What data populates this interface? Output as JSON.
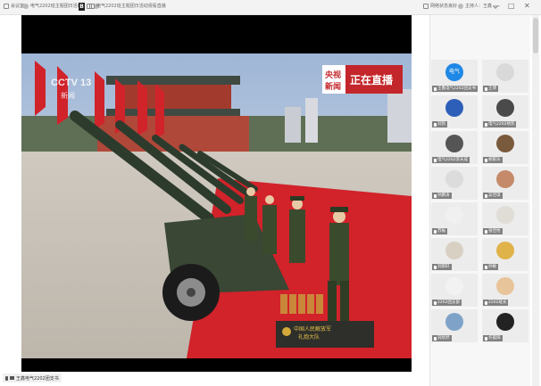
{
  "topbar": {
    "tab1": "会议室",
    "tab2": "电气2202班主题团日活动",
    "tab3": "电气2202班主题团日活动观看直播",
    "right1": "网络状态良好",
    "right2": "主持人：王鑫"
  },
  "window_controls": {
    "min": "—",
    "max": "□",
    "close": "✕"
  },
  "video": {
    "network_logo_line1": "CCTV 13",
    "network_logo_line2": "新闻",
    "live_bug_line1": "央视",
    "live_bug_line2": "新闻",
    "live_bug_label": "正在直播",
    "banner_line1": "中国人民解放军",
    "banner_line2": "礼炮大队"
  },
  "self_view": {
    "name": "王鑫电气2202团支书"
  },
  "participants": [
    {
      "name": "王鑫电气2202团支书",
      "avatar_text": "电气",
      "avatar_color": "#1e88e5",
      "icon": "mic-icon"
    },
    {
      "name": "王博",
      "avatar_text": "",
      "avatar_color": "#d9d9d9",
      "icon": "mic-icon"
    },
    {
      "name": "刘凯",
      "avatar_text": "",
      "avatar_color": "#2e5fb8",
      "icon": "mic-icon"
    },
    {
      "name": "电气2202杨凯",
      "avatar_text": "",
      "avatar_color": "#4a4a4a",
      "icon": "mic-icon"
    },
    {
      "name": "电气2202李天成",
      "avatar_text": "",
      "avatar_color": "#555555",
      "icon": "mic-icon"
    },
    {
      "name": "胡家乐",
      "avatar_text": "",
      "avatar_color": "#7a5a3c",
      "icon": "mic-icon"
    },
    {
      "name": "孙鹏涛",
      "avatar_text": "",
      "avatar_color": "#dcdcdc",
      "icon": "mic-icon"
    },
    {
      "name": "吴佳琪",
      "avatar_text": "",
      "avatar_color": "#c48a6a",
      "icon": "mic-icon"
    },
    {
      "name": "苏振",
      "avatar_text": "",
      "avatar_color": "#f0f0f0",
      "icon": "mic-icon"
    },
    {
      "name": "张佳怡",
      "avatar_text": "",
      "avatar_color": "#e0dcd6",
      "icon": "mic-icon"
    },
    {
      "name": "刘雨轩",
      "avatar_text": "",
      "avatar_color": "#d9d0c4",
      "icon": "mic-icon"
    },
    {
      "name": "孙敏",
      "avatar_text": "",
      "avatar_color": "#e0b24a",
      "icon": "mic-icon"
    },
    {
      "name": "2202团支部",
      "avatar_text": "",
      "avatar_color": "#f2f2f2",
      "icon": "mic-icon"
    },
    {
      "name": "2202班长",
      "avatar_text": "",
      "avatar_color": "#e8c49a",
      "icon": "mic-icon"
    },
    {
      "name": "刘欣然",
      "avatar_text": "",
      "avatar_color": "#7fa3c8",
      "icon": "mic-icon"
    },
    {
      "name": "许晨阳",
      "avatar_text": "",
      "avatar_color": "#222222",
      "icon": "mic-icon"
    }
  ]
}
